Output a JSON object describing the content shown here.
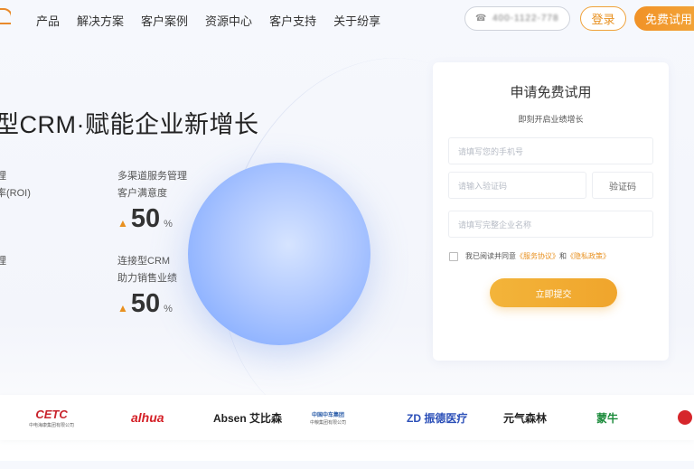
{
  "header": {
    "nav": [
      "产品",
      "解决方案",
      "客户案例",
      "资源中心",
      "客户支持",
      "关于纷享"
    ],
    "phone_number": "400-1122-778",
    "login_label": "登录",
    "trial_label": "免费试用"
  },
  "hero": {
    "title": "型CRM·赋能企业新增长",
    "metrics": [
      {
        "line1": "理",
        "line2": "率(ROI)",
        "value": "",
        "unit": ""
      },
      {
        "line1": "多渠道服务管理",
        "line2": "客户满意度",
        "value": "50",
        "unit": "%"
      },
      {
        "line1": "理",
        "line2": "",
        "value": "",
        "unit": ""
      },
      {
        "line1": "连接型CRM",
        "line2": "助力销售业绩",
        "value": "50",
        "unit": "%"
      }
    ]
  },
  "form": {
    "title": "申请免费试用",
    "subtitle": "即刻开启业绩增长",
    "phone_placeholder": "请填写您的手机号",
    "code_placeholder": "请输入验证码",
    "code_button": "验证码",
    "company_placeholder": "请填写完整企业名称",
    "agree_prefix": "我已阅读并同意",
    "service_link": "《服务协议》",
    "and": "和",
    "privacy_link": "《隐私政策》",
    "submit_label": "立即提交"
  },
  "logos": [
    {
      "name": "CETC",
      "sub": "中电海康集团有限公司",
      "color": "#c8232c"
    },
    {
      "name": "alhua",
      "sub": "",
      "color": "#d41f26"
    },
    {
      "name": "Absen 艾比森",
      "sub": "",
      "color": "#222222"
    },
    {
      "name": "中国中车集团",
      "sub": "中粮集团有限公司",
      "color": "#2a5ca8"
    },
    {
      "name": "ZD 振德医疗",
      "sub": "",
      "color": "#2b4fb8"
    },
    {
      "name": "元气森林",
      "sub": "",
      "color": "#222222"
    },
    {
      "name": "蒙牛",
      "sub": "",
      "color": "#1a8a3a"
    }
  ],
  "colors": {
    "accent": "#f0a23a",
    "sphere": "#9dbcff"
  }
}
